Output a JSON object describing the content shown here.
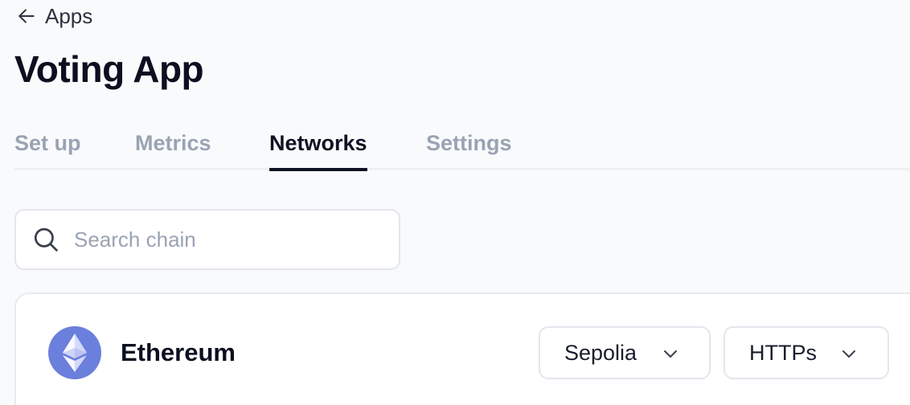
{
  "nav": {
    "back_label": "Apps"
  },
  "page": {
    "title": "Voting App"
  },
  "tabs": [
    {
      "label": "Set up",
      "active": false
    },
    {
      "label": "Metrics",
      "active": false
    },
    {
      "label": "Networks",
      "active": true
    },
    {
      "label": "Settings",
      "active": false
    }
  ],
  "search": {
    "placeholder": "Search chain",
    "value": ""
  },
  "chains": [
    {
      "name": "Ethereum",
      "logo": "ethereum-icon",
      "logo_color": "#6b7fdc",
      "network": "Sepolia",
      "protocol": "HTTPs"
    }
  ],
  "colors": {
    "background": "#f9fafc",
    "text_primary": "#0f1222",
    "text_muted": "#9aa3b3",
    "border": "#e3e6ec"
  }
}
